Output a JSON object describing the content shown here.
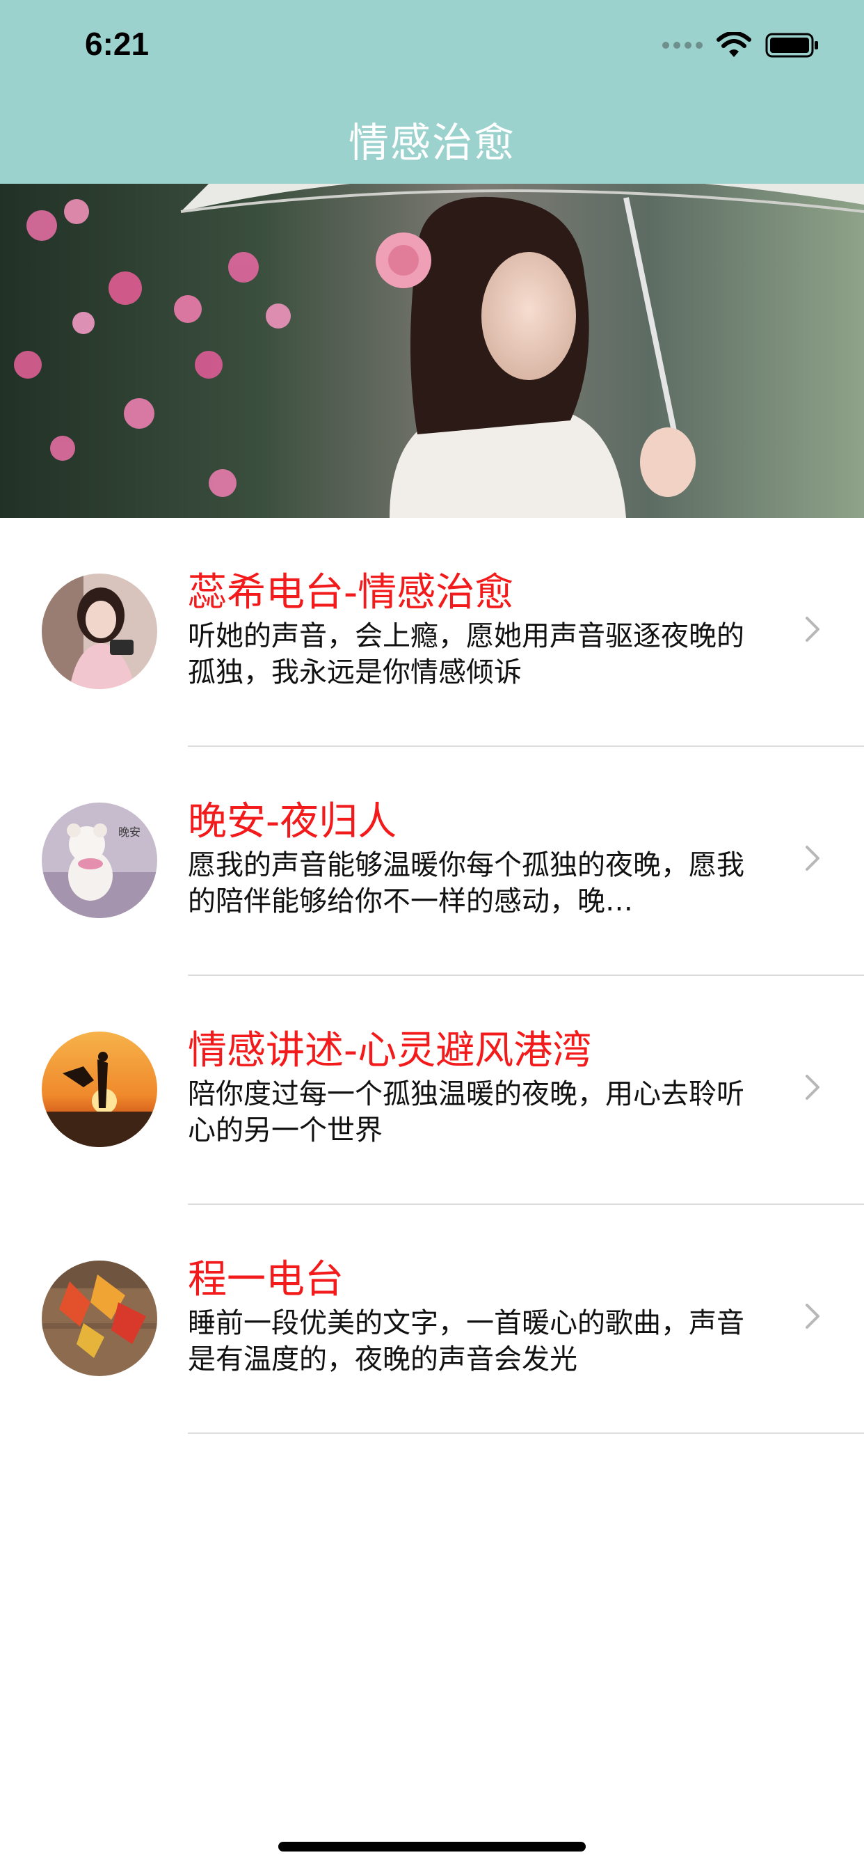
{
  "status_bar": {
    "time": "6:21",
    "icons": [
      "cellular-signal-icon",
      "wifi-icon",
      "battery-icon"
    ]
  },
  "nav": {
    "title": "情感治愈"
  },
  "banner": {
    "image": "banner-photo-girl-with-umbrella"
  },
  "colors": {
    "nav_background": "#9bd2ce",
    "nav_title": "#ffffff",
    "item_title": "#f21a1a",
    "item_desc": "#111111",
    "separator": "#dddddd"
  },
  "items": [
    {
      "title": "蕊希电台-情感治愈",
      "desc": "听她的声音，会上瘾，愿她用声音驱逐夜晚的孤独，我永远是你情感倾诉",
      "avatar": "avatar-girl-with-camera"
    },
    {
      "title": "晚安-夜归人",
      "desc": "愿我的声音能够温暖你每个孤独的夜晚，愿我的陪伴能够给你不一样的感动，晚…",
      "avatar": "avatar-teddy-bear-goodnight"
    },
    {
      "title": "情感讲述-心灵避风港湾",
      "desc": "陪你度过每一个孤独温暖的夜晚，用心去聆听心的另一个世界",
      "avatar": "avatar-couple-sunset"
    },
    {
      "title": "程一电台",
      "desc": "睡前一段优美的文字，一首暖心的歌曲，声音是有温度的，夜晚的声音会发光",
      "avatar": "avatar-autumn-leaves"
    }
  ]
}
